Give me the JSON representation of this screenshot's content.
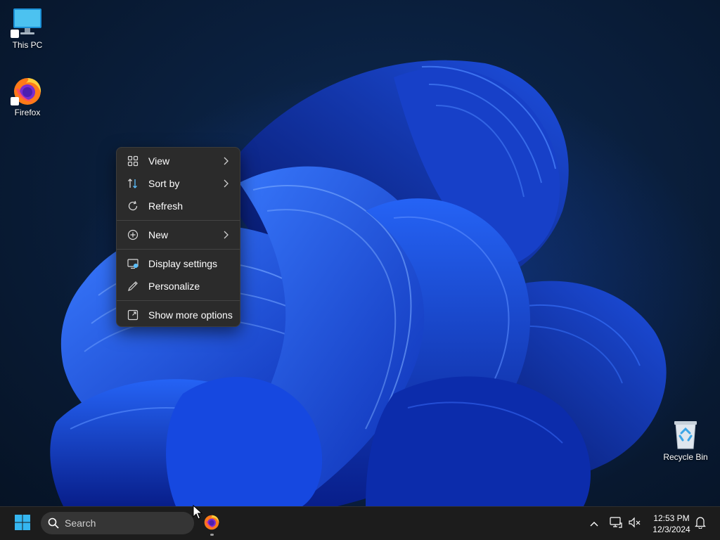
{
  "desktop": {
    "icons": [
      {
        "label": "This PC",
        "icon": "monitor-icon"
      },
      {
        "label": "Firefox",
        "icon": "firefox-icon"
      },
      {
        "label": "Recycle Bin",
        "icon": "recycle-bin-icon"
      }
    ]
  },
  "context_menu": {
    "items": [
      {
        "label": "View",
        "icon": "grid-view-icon",
        "submenu": true
      },
      {
        "label": "Sort by",
        "icon": "sort-arrows-icon",
        "submenu": true
      },
      {
        "label": "Refresh",
        "icon": "refresh-icon",
        "submenu": false
      },
      {
        "label": "New",
        "icon": "plus-circle-icon",
        "submenu": true
      },
      {
        "label": "Display settings",
        "icon": "display-settings-icon",
        "submenu": false
      },
      {
        "label": "Personalize",
        "icon": "pen-icon",
        "submenu": false
      },
      {
        "label": "Show more options",
        "icon": "show-more-options-icon",
        "submenu": false
      }
    ]
  },
  "taskbar": {
    "search_placeholder": "Search",
    "pinned": [
      {
        "name": "Firefox",
        "icon": "firefox-icon",
        "running": true
      }
    ],
    "tray": {
      "icons": [
        "chevron-up-icon",
        "network-icon",
        "volume-muted-icon",
        "notification-bell-icon"
      ],
      "time": "12:53 PM",
      "date": "12/3/2024"
    }
  },
  "colors": {
    "accent": "#2f6bff",
    "menu_background": "#2b2b2b",
    "taskbar_background": "#1c1c1c",
    "start_blue": "#35b6f0"
  }
}
